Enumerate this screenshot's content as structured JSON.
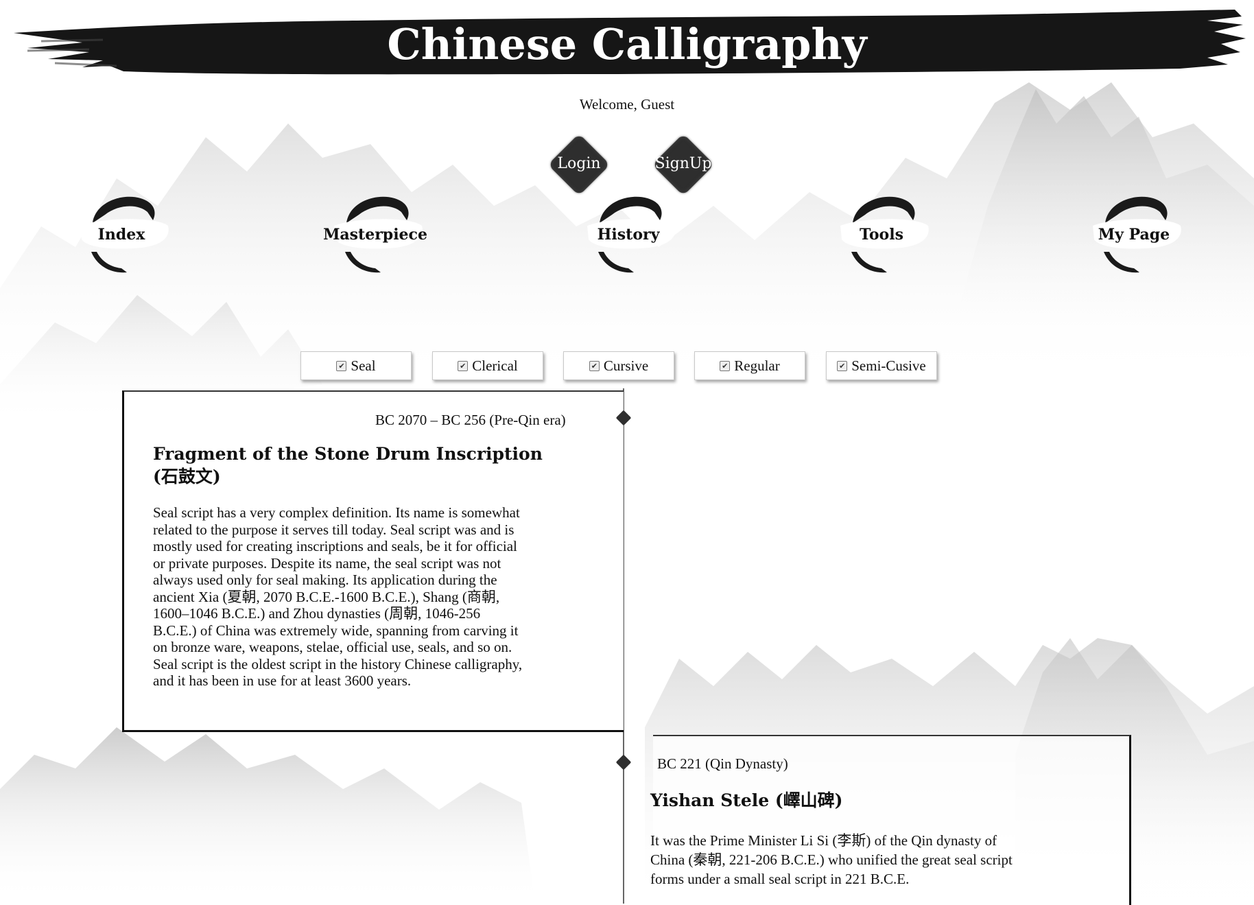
{
  "header": {
    "title": "Chinese Calligraphy",
    "welcome": "Welcome, Guest"
  },
  "auth": {
    "login_label": "Login",
    "signup_label": "SignUp"
  },
  "nav": {
    "items": [
      {
        "label": "Index"
      },
      {
        "label": "Masterpiece"
      },
      {
        "label": "History"
      },
      {
        "label": "Tools"
      },
      {
        "label": "My Page"
      }
    ]
  },
  "filters": [
    {
      "label": "Seal",
      "checked": true
    },
    {
      "label": "Clerical",
      "checked": true
    },
    {
      "label": "Cursive",
      "checked": true
    },
    {
      "label": "Regular",
      "checked": true
    },
    {
      "label": "Semi-Cusive",
      "checked": true
    }
  ],
  "checkmark": "✔",
  "timeline": {
    "entries": [
      {
        "date": "BC 2070 – BC 256 (Pre-Qin era)",
        "title_line1": "Fragment of the Stone Drum Inscription",
        "title_line2": "(石鼓文)",
        "body": "Seal script has a very complex definition. Its name is somewhat related to the purpose it serves till today. Seal script was and is mostly used for creating inscriptions and seals, be it for official or private purposes. Despite its name, the seal script was not always used only for seal making. Its application during the ancient Xia (夏朝, 2070 B.C.E.-1600 B.C.E.), Shang (商朝, 1600–1046 B.C.E.) and Zhou dynasties (周朝, 1046-256 B.C.E.) of China was extremely wide, spanning from carving it on bronze ware, weapons, stelae, official use, seals, and so on. Seal script is the oldest script in the history Chinese calligraphy, and it has been in use for at least 3600 years."
      },
      {
        "date": "BC 221 (Qin Dynasty)",
        "title_line1": "Yishan Stele (嶧山碑)",
        "body": "It was the Prime Minister Li Si (李斯) of the Qin dynasty of China (秦朝, 221-206 B.C.E.) who unified the great seal script forms under a small seal script in 221 B.C.E."
      }
    ]
  },
  "colors": {
    "ink": "#111111",
    "mountain": "#d6d6d6",
    "background": "#ffffff"
  }
}
